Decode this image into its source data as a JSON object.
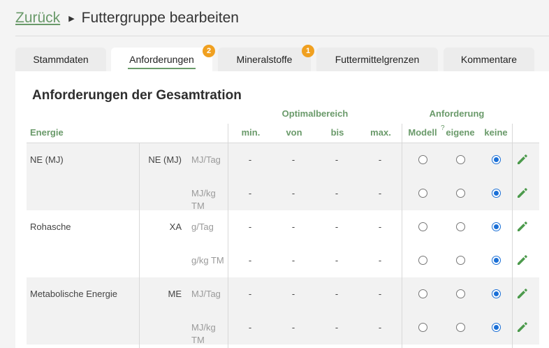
{
  "header": {
    "back_label": "Zurück",
    "title": "Futtergruppe bearbeiten"
  },
  "tabs": [
    {
      "label": "Stammdaten",
      "active": false
    },
    {
      "label": "Anforderungen",
      "active": true,
      "badge": "2"
    },
    {
      "label": "Mineralstoffe",
      "active": false,
      "badge": "1"
    },
    {
      "label": "Futtermittelgrenzen",
      "active": false
    },
    {
      "label": "Kommentare",
      "active": false
    }
  ],
  "section": {
    "title": "Anforderungen der Gesamtration",
    "group_optimal": "Optimalbereich",
    "group_anforderung": "Anforderung",
    "col_energie": "Energie",
    "col_min": "min.",
    "col_von": "von",
    "col_bis": "bis",
    "col_max": "max.",
    "col_modell": "Modell",
    "col_eigene": "eigene",
    "col_keine": "keine",
    "help_mark": "?"
  },
  "rows": [
    {
      "name": "NE (MJ)",
      "abbr": "NE (MJ)",
      "unit": "MJ/Tag",
      "min": "-",
      "von": "-",
      "bis": "-",
      "max": "-",
      "selection": "keine"
    },
    {
      "name": "",
      "abbr": "",
      "unit": "MJ/kg TM",
      "min": "-",
      "von": "-",
      "bis": "-",
      "max": "-",
      "selection": "keine"
    },
    {
      "name": "Rohasche",
      "abbr": "XA",
      "unit": "g/Tag",
      "min": "-",
      "von": "-",
      "bis": "-",
      "max": "-",
      "selection": "keine"
    },
    {
      "name": "",
      "abbr": "",
      "unit": "g/kg TM",
      "min": "-",
      "von": "-",
      "bis": "-",
      "max": "-",
      "selection": "keine"
    },
    {
      "name": "Metabolische Energie",
      "abbr": "ME",
      "unit": "MJ/Tag",
      "min": "-",
      "von": "-",
      "bis": "-",
      "max": "-",
      "selection": "keine"
    },
    {
      "name": "",
      "abbr": "",
      "unit": "MJ/kg TM",
      "min": "-",
      "von": "-",
      "bis": "-",
      "max": "-",
      "selection": "keine"
    }
  ],
  "colors": {
    "accent": "#6a9a6a",
    "badge": "#f0a020",
    "radio": "#1a6fd6",
    "edit_icon": "#4c9a4c"
  },
  "icons": {
    "edit": "pencil-icon",
    "breadcrumb": "caret-right-icon"
  }
}
